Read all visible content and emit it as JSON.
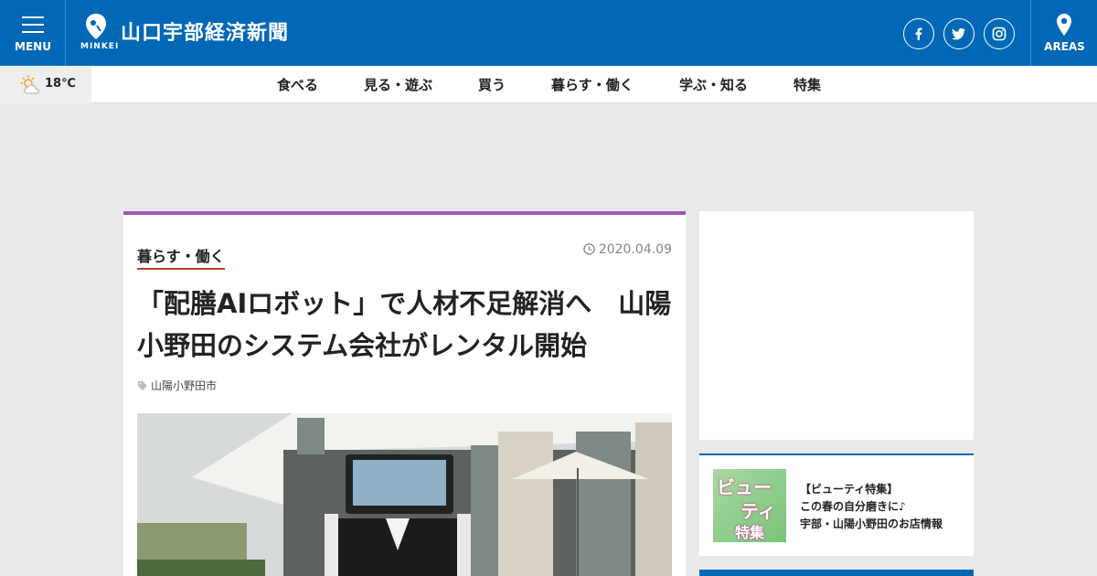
{
  "header": {
    "menu_label": "MENU",
    "site_title": "山口宇部経済新聞",
    "logo_sub": "MINKEI",
    "areas_label": "AREAS",
    "social": [
      {
        "name": "facebook-icon"
      },
      {
        "name": "twitter-icon"
      },
      {
        "name": "instagram-icon"
      }
    ],
    "brand_color": "#0068b7"
  },
  "weather": {
    "temperature": "18℃",
    "icon": "partly-cloudy-icon"
  },
  "nav": {
    "items": [
      "食べる",
      "見る・遊ぶ",
      "買う",
      "暮らす・働く",
      "学ぶ・知る",
      "特集"
    ]
  },
  "article": {
    "category": "暮らす・働く",
    "date": "2020.04.09",
    "title": "「配膳AIロボット」で人材不足解消へ　山陽小野田のシステム会社がレンタル開始",
    "tag": "山陽小野田市",
    "accent_color": "#9b59b6"
  },
  "sidebar": {
    "feature": {
      "thumb_line1": "ビュー",
      "thumb_line2": "ティ",
      "thumb_line3": "特集",
      "lines": [
        "【ビューティ特集】",
        "この春の自分磨きに♪",
        "宇部・山陽小野田のお店情報"
      ]
    }
  }
}
